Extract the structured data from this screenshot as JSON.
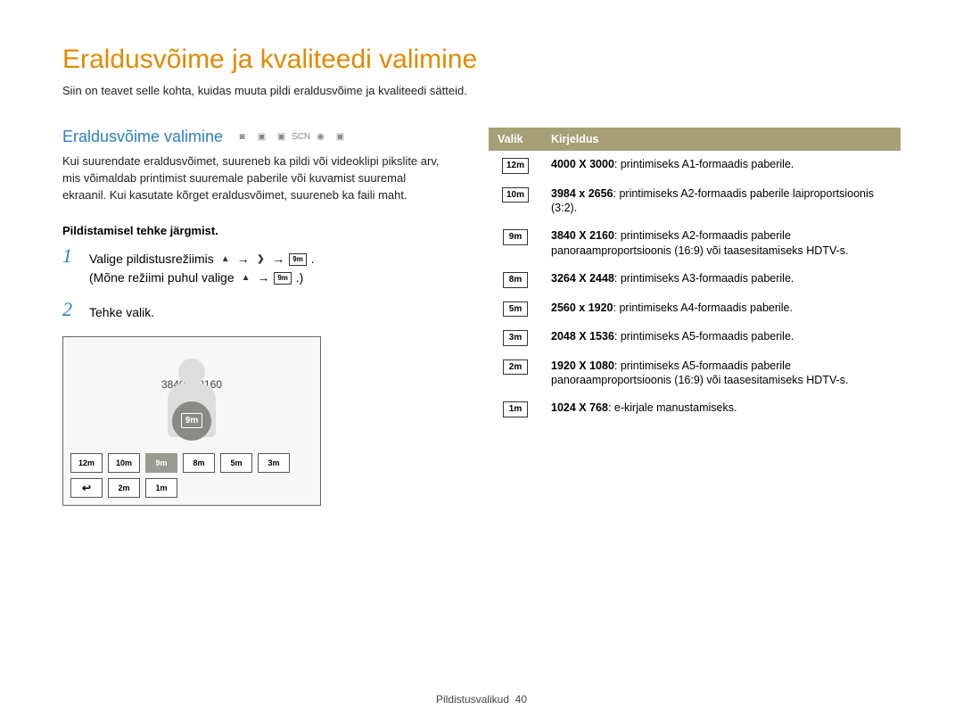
{
  "page": {
    "title": "Eraldusvõime ja kvaliteedi valimine",
    "subtitle": "Siin on teavet selle kohta, kuidas muuta pildi eraldusvõime ja kvaliteedi sätteid."
  },
  "section": {
    "heading": "Eraldusvõime valimine",
    "body": "Kui suurendate eraldusvõimet, suureneb ka pildi või videoklipi pikslite arv, mis võimaldab printimist suuremale paberile või kuvamist suuremal ekraanil. Kui kasutate kõrget eraldusvõimet, suureneb ka faili maht.",
    "subheading": "Pildistamisel tehke järgmist."
  },
  "steps": {
    "s1_a": "Valige pildistusrežiimis ",
    "s1_b": " → ",
    "s1_c": " → ",
    "s1_d": ".",
    "s1_e": "(Mõne režiimi puhul valige ",
    "s1_f": " → ",
    "s1_g": ".)",
    "s2": "Tehke valik."
  },
  "screen": {
    "resolution_label": "3840 X 2160",
    "options_row1": [
      "12m",
      "10m",
      "9m",
      "8m",
      "5m",
      "3m"
    ],
    "selected_index": 2,
    "options_row2": [
      "2m",
      "1m"
    ],
    "badge_text": "9m"
  },
  "table": {
    "headers": {
      "valik": "Valik",
      "kirjeldus": "Kirjeldus"
    },
    "rows": [
      {
        "opt": "12m",
        "res": "4000 X 3000",
        "desc": ": printimiseks A1-formaadis paberile."
      },
      {
        "opt": "10m",
        "res": "3984 x 2656",
        "desc": ": printimiseks A2-formaadis paberile laiproportsioonis (3:2)."
      },
      {
        "opt": "9m",
        "res": "3840 X 2160",
        "desc": ": printimiseks A2-formaadis paberile panoraamproportsioonis (16:9) või taasesitamiseks HDTV-s."
      },
      {
        "opt": "8m",
        "res": "3264 X 2448",
        "desc": ": printimiseks A3-formaadis paberile."
      },
      {
        "opt": "5m",
        "res": "2560 x 1920",
        "desc": ": printimiseks A4-formaadis paberile."
      },
      {
        "opt": "3m",
        "res": "2048 X 1536",
        "desc": ": printimiseks A5-formaadis paberile."
      },
      {
        "opt": "2m",
        "res": "1920 X 1080",
        "desc": ": printimiseks A5-formaadis paberile panoraamproportsioonis (16:9) või taasesitamiseks HDTV-s."
      },
      {
        "opt": "1m",
        "res": "1024 X 768",
        "desc": ": e-kirjale manustamiseks."
      }
    ]
  },
  "footer": {
    "section": "Pildistusvalikud",
    "page": "40"
  }
}
